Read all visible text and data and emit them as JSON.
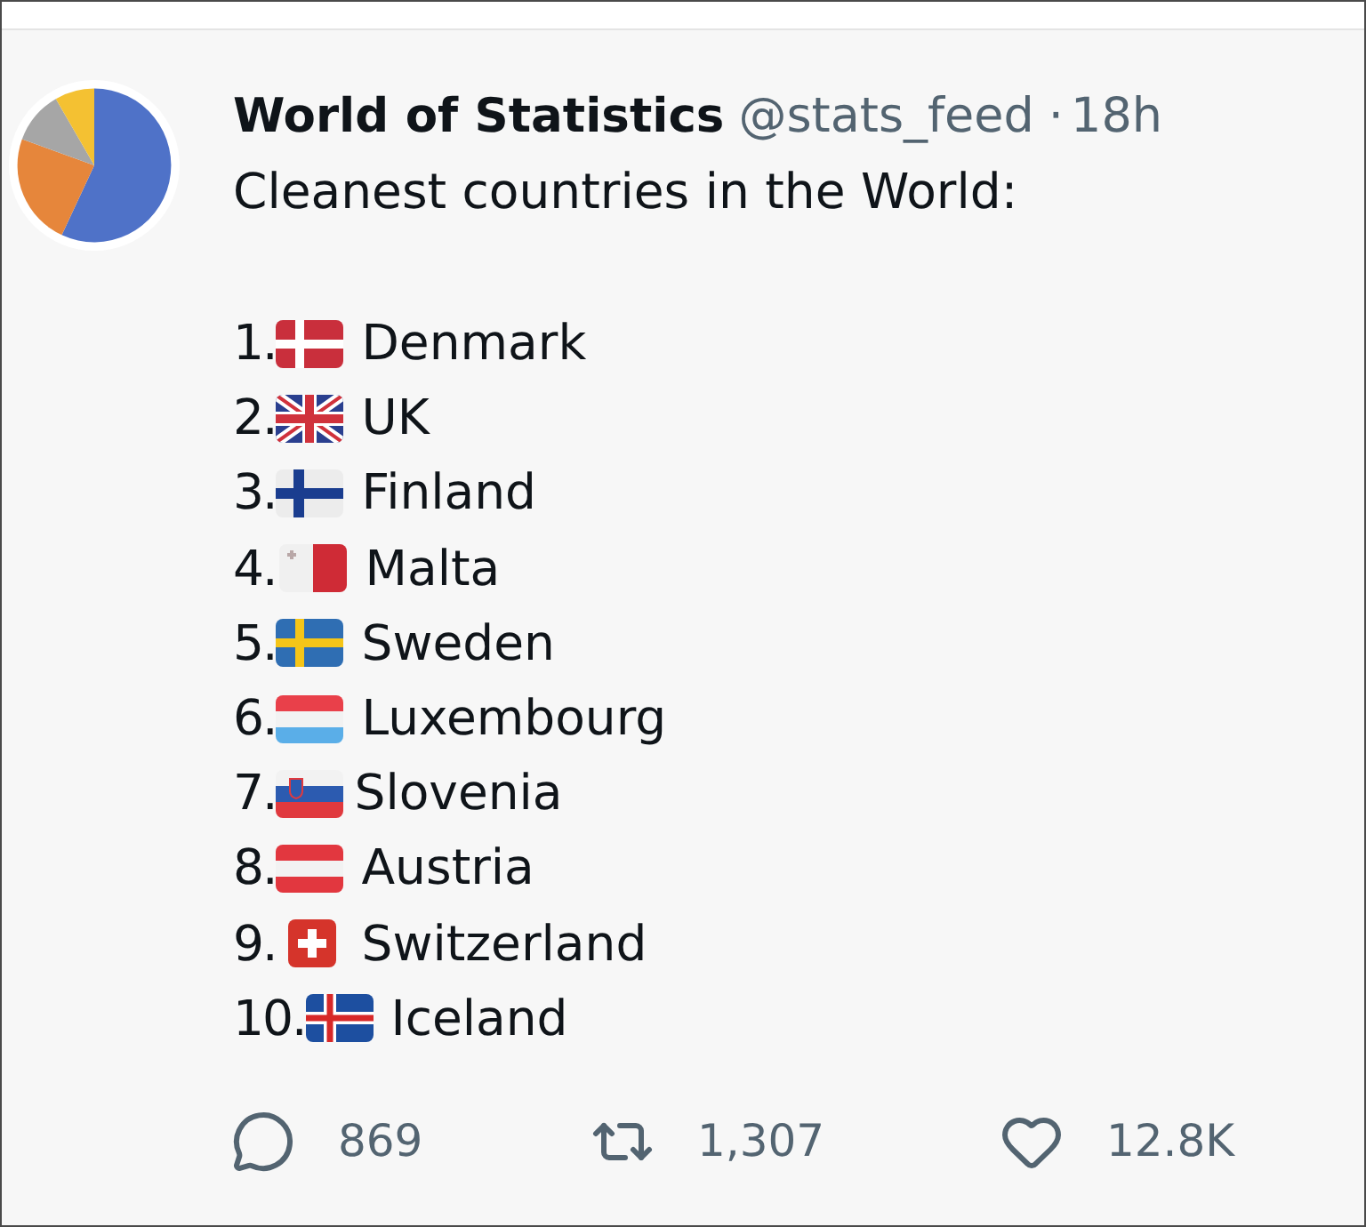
{
  "author": {
    "name": "World of Statistics",
    "handle": "@stats_feed",
    "separator": "·",
    "time": "18h"
  },
  "post": {
    "intro": "Cleanest countries in the World:",
    "items": [
      {
        "number": "1.",
        "country": "Denmark"
      },
      {
        "number": "2.",
        "country": "UK"
      },
      {
        "number": "3.",
        "country": "Finland"
      },
      {
        "number": "4.",
        "country": "Malta"
      },
      {
        "number": "5.",
        "country": "Sweden"
      },
      {
        "number": "6.",
        "country": "Luxembourg"
      },
      {
        "number": "7.",
        "country": "Slovenia"
      },
      {
        "number": "8.",
        "country": "Austria"
      },
      {
        "number": "9.",
        "country": "Switzerland"
      },
      {
        "number": "10.",
        "country": "Iceland"
      }
    ]
  },
  "actions": [
    {
      "kind": "reply",
      "count": "869"
    },
    {
      "kind": "repost",
      "count": "1,307"
    },
    {
      "kind": "like",
      "count": "12.8K"
    }
  ]
}
